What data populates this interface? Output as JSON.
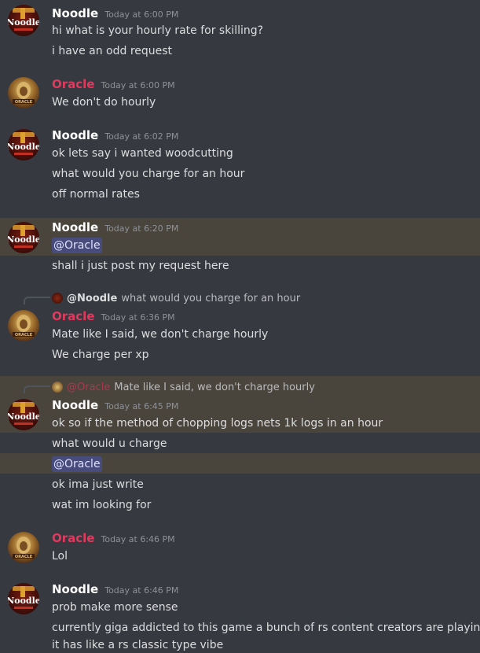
{
  "colors": {
    "background": "#36393f",
    "highlight_band": "#49443c",
    "oracle_name": "#e3395f",
    "mention_bg": "#484c7c",
    "timestamp": "#8e9297"
  },
  "avatars": {
    "noodle_text": "Noodle",
    "oracle_text": "ORACLE"
  },
  "messages": [
    {
      "author": "Noodle",
      "time": "Today at 6:00 PM",
      "lines": [
        "hi what is your hourly rate for skilling?",
        "i have an odd request"
      ]
    },
    {
      "author": "Oracle",
      "time": "Today at 6:00 PM",
      "lines": [
        "We don't do hourly"
      ]
    },
    {
      "author": "Noodle",
      "time": "Today at 6:02 PM",
      "lines": [
        "ok lets say i wanted woodcutting",
        "what would you charge for an hour",
        "off normal rates"
      ]
    },
    {
      "author": "Noodle",
      "time": "Today at 6:20 PM",
      "mention": "@Oracle",
      "lines": [
        "shall i just post my request here"
      ]
    },
    {
      "reply": {
        "name": "@Noodle",
        "text": "what would you charge for an hour"
      },
      "author": "Oracle",
      "time": "Today at 6:36 PM",
      "lines": [
        "Mate like I said, we don't charge hourly",
        "We charge per xp"
      ]
    },
    {
      "reply": {
        "name": "@Oracle",
        "text": "Mate like I said, we don't charge hourly"
      },
      "author": "Noodle",
      "time": "Today at 6:45 PM",
      "lines": [
        "ok so if the method of chopping logs nets 1k logs in an hour",
        "what would u charge"
      ],
      "mention": "@Oracle",
      "lines2": [
        "ok ima just write",
        "wat im looking for"
      ]
    },
    {
      "author": "Oracle",
      "time": "Today at 6:46 PM",
      "lines": [
        "Lol"
      ]
    },
    {
      "author": "Noodle",
      "time": "Today at 6:46 PM",
      "lines": [
        "prob make more sense",
        "currently giga addicted to this game a bunch of rs content creators are playing]",
        "it has like a rs classic type vibe"
      ]
    }
  ]
}
